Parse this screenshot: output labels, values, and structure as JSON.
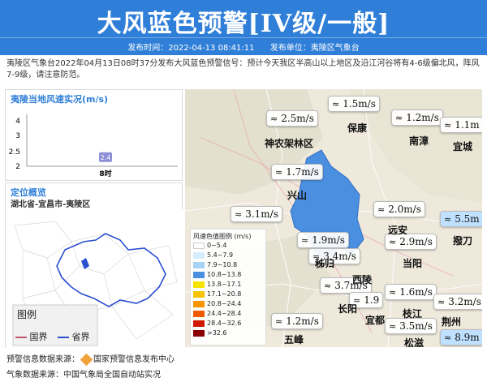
{
  "header": {
    "title": "大风蓝色预警[IV级/一般]",
    "publish_time": "发布时间：2022-04-13 08:41:11",
    "publisher": "发布单位：夷陵区气象台"
  },
  "description": "夷陵区气象台2022年04月13日08时37分发布大风蓝色预警信号：预计今天我区半高山以上地区及沿江河谷将有4-6级偏北风，阵风7-9级，请注意防范。",
  "wind_panel": {
    "title": "夷陵当地风速实况(m/s)",
    "chart_data": {
      "type": "line",
      "categories": [
        "8时"
      ],
      "values": [
        2.4
      ],
      "ylim": [
        2,
        4
      ],
      "yticks": [
        "4",
        "3",
        "2.5",
        "2"
      ]
    },
    "data_label": "2.4"
  },
  "location_panel": {
    "title": "定位概览",
    "subtitle": "湖北省-宜昌市-夷陵区",
    "legend_title": "图例",
    "legend_items": [
      {
        "label": "国界",
        "color": "#c0566a"
      },
      {
        "label": "省界",
        "color": "#2a4fd0"
      }
    ]
  },
  "map": {
    "stations": [
      {
        "value": "1.5m/s"
      },
      {
        "value": "2.5m/s"
      },
      {
        "value": "1.2m/s"
      },
      {
        "value": "1.1m"
      },
      {
        "value": "1.7m/s"
      },
      {
        "value": "2.0m/s"
      },
      {
        "value": "3.1m/s"
      },
      {
        "value": "5.5m"
      },
      {
        "value": "1.9m/s"
      },
      {
        "value": "2.9m/s"
      },
      {
        "value": "3.4m/s"
      },
      {
        "value": "1.6m/s"
      },
      {
        "value": "3.7m/s"
      },
      {
        "value": "1.9"
      },
      {
        "value": "3.2m/s"
      },
      {
        "value": "1.2m/s"
      },
      {
        "value": "3.5m/s"
      },
      {
        "value": "8.9m"
      }
    ],
    "cities": [
      "保康",
      "南漳",
      "神农架林区",
      "宜城",
      "兴山",
      "远安",
      "撥刀",
      "秭归",
      "西陵",
      "当阳",
      "长阳",
      "宜都",
      "枝江",
      "荆州",
      "五峰",
      "松滋"
    ],
    "legend": {
      "title": "风速色值图例 (m/s)",
      "items": [
        {
          "label": "0~5.4",
          "color": "#ffffff"
        },
        {
          "label": "5.4~7.9",
          "color": "#d6ecff"
        },
        {
          "label": "7.9~10.8",
          "color": "#a9d3f5"
        },
        {
          "label": "10.8~13.8",
          "color": "#4b8fe0"
        },
        {
          "label": "13.8~17.1",
          "color": "#f6e400"
        },
        {
          "label": "17.1~20.8",
          "color": "#f6c400"
        },
        {
          "label": "20.8~24.4",
          "color": "#f79400"
        },
        {
          "label": "24.4~28.4",
          "color": "#f15a00"
        },
        {
          "label": "28.4~32.6",
          "color": "#d01a00"
        },
        {
          "label": ">32.6",
          "color": "#8a0000"
        }
      ]
    }
  },
  "footer": {
    "warning_source_label": "预警信息数据来源：",
    "warning_source": "国家预警信息发布中心",
    "weather_source_label": "气象数据来源：",
    "weather_source": "中国气象局全国自动站实况"
  }
}
